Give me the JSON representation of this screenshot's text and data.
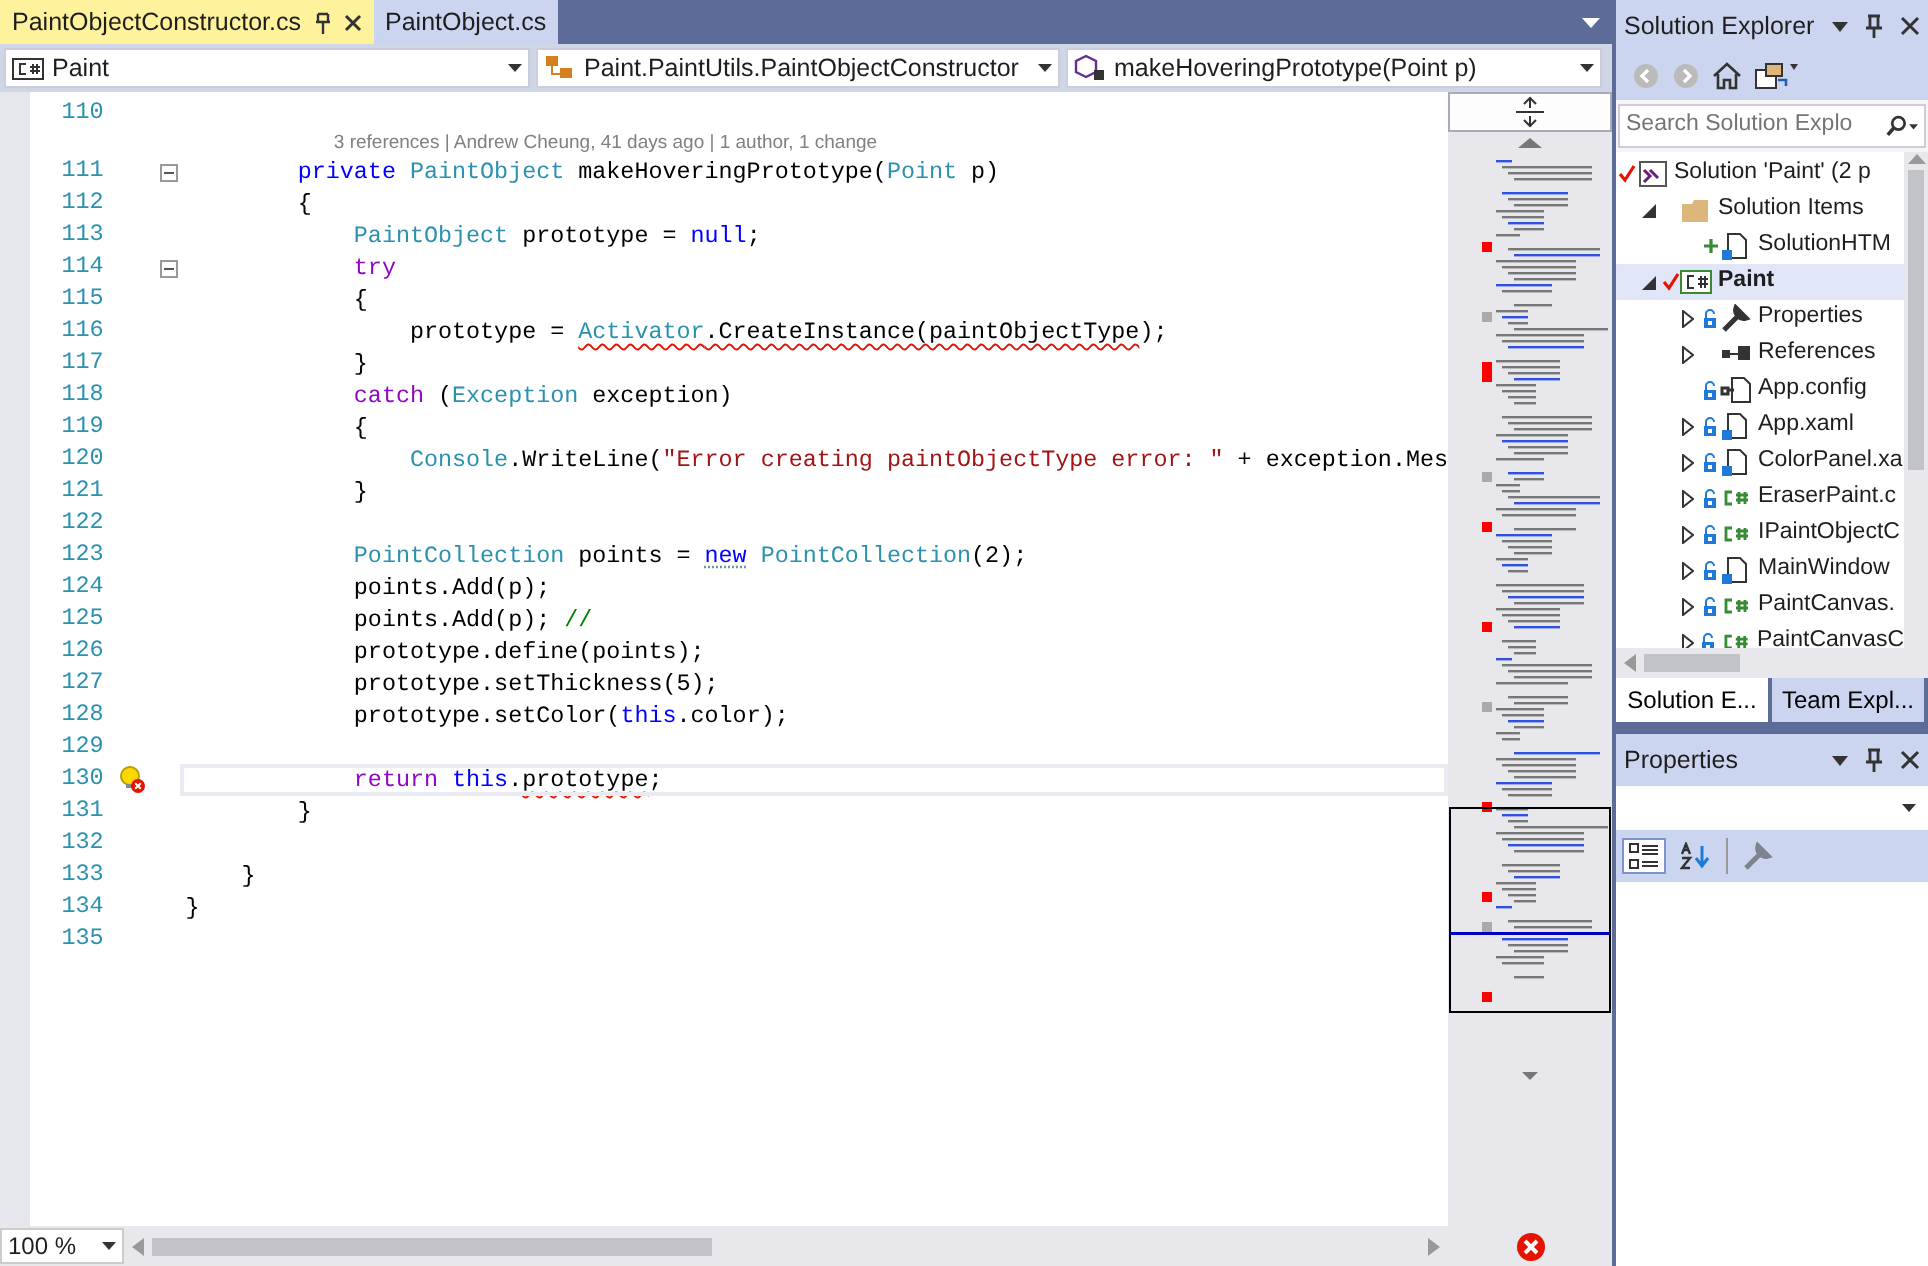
{
  "editor_tabs": [
    {
      "label": "PaintObjectConstructor.cs",
      "selected": true
    },
    {
      "label": "PaintObject.cs",
      "selected": false
    }
  ],
  "nav_bar": [
    {
      "kind": "project",
      "label": "Paint"
    },
    {
      "kind": "class",
      "label": "Paint.PaintUtils.PaintObjectConstructor"
    },
    {
      "kind": "member",
      "label": "makeHoveringPrototype(Point p)"
    }
  ],
  "code_lines": [
    {
      "number": "110",
      "fold": false,
      "current": false,
      "lightbulb": false
    },
    {
      "number": "111",
      "fold": true,
      "current": false,
      "lightbulb": false,
      "code_lens": "3 references | Andrew Cheung, 41 days ago | 1 author, 1 change",
      "tokens": [
        {
          "t": "        private ",
          "kind": "keyword"
        },
        {
          "t": "PaintObject",
          "kind": "type"
        },
        {
          "t": " makeHoveringPrototype(",
          "kind": "plain"
        },
        {
          "t": "Point",
          "kind": "type"
        },
        {
          "t": " p)",
          "kind": "plain"
        }
      ]
    },
    {
      "number": "112",
      "fold": false,
      "current": false,
      "lightbulb": false,
      "tokens": [
        {
          "t": "        {",
          "kind": "plain"
        }
      ]
    },
    {
      "number": "113",
      "fold": false,
      "current": false,
      "lightbulb": false,
      "tokens": [
        {
          "t": "            PaintObject",
          "kind": "type"
        },
        {
          "t": " prototype = ",
          "kind": "plain"
        },
        {
          "t": "null",
          "kind": "keyword"
        },
        {
          "t": ";",
          "kind": "plain"
        }
      ]
    },
    {
      "number": "114",
      "fold": true,
      "current": false,
      "lightbulb": false,
      "tokens": [
        {
          "t": "            try",
          "kind": "control"
        }
      ]
    },
    {
      "number": "115",
      "fold": false,
      "current": false,
      "lightbulb": false,
      "tokens": [
        {
          "t": "            {",
          "kind": "plain"
        }
      ]
    },
    {
      "number": "116",
      "fold": false,
      "current": false,
      "lightbulb": false,
      "tokens": [
        {
          "t": "                prototype = ",
          "kind": "plain"
        },
        {
          "t": "Activator",
          "kind": "type",
          "error_underline": true
        },
        {
          "t": ".CreateInstance(paintObjectType",
          "kind": "plain",
          "error_underline": true
        },
        {
          "t": ");",
          "kind": "plain"
        }
      ]
    },
    {
      "number": "117",
      "fold": false,
      "current": false,
      "lightbulb": false,
      "tokens": [
        {
          "t": "            }",
          "kind": "plain"
        }
      ]
    },
    {
      "number": "118",
      "fold": false,
      "current": false,
      "lightbulb": false,
      "tokens": [
        {
          "t": "            catch",
          "kind": "control"
        },
        {
          "t": " (",
          "kind": "plain"
        },
        {
          "t": "Exception",
          "kind": "type"
        },
        {
          "t": " exception)",
          "kind": "plain"
        }
      ]
    },
    {
      "number": "119",
      "fold": false,
      "current": false,
      "lightbulb": false,
      "tokens": [
        {
          "t": "            {",
          "kind": "plain"
        }
      ]
    },
    {
      "number": "120",
      "fold": false,
      "current": false,
      "lightbulb": false,
      "tokens": [
        {
          "t": "                Console",
          "kind": "type"
        },
        {
          "t": ".WriteLine(",
          "kind": "plain"
        },
        {
          "t": "\"Error creating paintObjectType error: \"",
          "kind": "string"
        },
        {
          "t": " + exception.Mes",
          "kind": "plain"
        }
      ]
    },
    {
      "number": "121",
      "fold": false,
      "current": false,
      "lightbulb": false,
      "tokens": [
        {
          "t": "            }",
          "kind": "plain"
        }
      ]
    },
    {
      "number": "122",
      "fold": false,
      "current": false,
      "lightbulb": false
    },
    {
      "number": "123",
      "fold": false,
      "current": false,
      "lightbulb": false,
      "tokens": [
        {
          "t": "            PointCollection",
          "kind": "type"
        },
        {
          "t": " points = ",
          "kind": "plain"
        },
        {
          "t": "new",
          "kind": "keyword",
          "hint_underline": true
        },
        {
          "t": " PointCollection",
          "kind": "type"
        },
        {
          "t": "(2);",
          "kind": "plain"
        }
      ]
    },
    {
      "number": "124",
      "fold": false,
      "current": false,
      "lightbulb": false,
      "tokens": [
        {
          "t": "            points.Add(p);",
          "kind": "plain"
        }
      ]
    },
    {
      "number": "125",
      "fold": false,
      "current": false,
      "lightbulb": false,
      "tokens": [
        {
          "t": "            points.Add(p); ",
          "kind": "plain"
        },
        {
          "t": "//",
          "kind": "comment"
        }
      ]
    },
    {
      "number": "126",
      "fold": false,
      "current": false,
      "lightbulb": false,
      "tokens": [
        {
          "t": "            prototype.define(points);",
          "kind": "plain"
        }
      ]
    },
    {
      "number": "127",
      "fold": false,
      "current": false,
      "lightbulb": false,
      "tokens": [
        {
          "t": "            prototype.setThickness(5);",
          "kind": "plain"
        }
      ]
    },
    {
      "number": "128",
      "fold": false,
      "current": false,
      "lightbulb": false,
      "tokens": [
        {
          "t": "            prototype.setColor(",
          "kind": "plain"
        },
        {
          "t": "this",
          "kind": "keyword"
        },
        {
          "t": ".color);",
          "kind": "plain"
        }
      ]
    },
    {
      "number": "129",
      "fold": false,
      "current": false,
      "lightbulb": false
    },
    {
      "number": "130",
      "fold": false,
      "current": true,
      "lightbulb": true,
      "tokens": [
        {
          "t": "            return ",
          "kind": "control"
        },
        {
          "t": "this",
          "kind": "keyword"
        },
        {
          "t": ".",
          "kind": "plain"
        },
        {
          "t": "prototype",
          "kind": "plain",
          "error_underline": true
        },
        {
          "t": ";",
          "kind": "plain"
        }
      ]
    },
    {
      "number": "131",
      "fold": false,
      "current": false,
      "lightbulb": false,
      "tokens": [
        {
          "t": "        }",
          "kind": "plain"
        }
      ]
    },
    {
      "number": "132",
      "fold": false,
      "current": false,
      "lightbulb": false
    },
    {
      "number": "133",
      "fold": false,
      "current": false,
      "lightbulb": false,
      "tokens": [
        {
          "t": "    }",
          "kind": "plain"
        }
      ]
    },
    {
      "number": "134",
      "fold": false,
      "current": false,
      "lightbulb": false,
      "tokens": [
        {
          "t": "}",
          "kind": "plain"
        }
      ]
    },
    {
      "number": "135",
      "fold": false,
      "current": false,
      "lightbulb": false
    }
  ],
  "zoom": "100 %",
  "solution_explorer": {
    "title": "Solution Explorer",
    "search": {
      "placeholder": "Search Solution Explo"
    },
    "tree": [
      {
        "label": "Solution 'Paint' (2 p",
        "kind": "solution",
        "edited": true,
        "added": false,
        "locked": false,
        "selected": false,
        "children": [
          {
            "label": "Solution Items",
            "kind": "folder",
            "expanded": true,
            "edited": false,
            "added": false,
            "locked": false,
            "selected": false,
            "children": [
              {
                "label": "SolutionHTM",
                "kind": "page",
                "edited": false,
                "added": true,
                "locked": false,
                "selected": false
              }
            ]
          },
          {
            "label": "Paint",
            "kind": "project",
            "expanded": true,
            "edited": true,
            "added": false,
            "locked": false,
            "selected": true,
            "children": [
              {
                "label": "Properties",
                "kind": "wrench",
                "expanded": false,
                "edited": false,
                "added": false,
                "locked": true,
                "selected": false
              },
              {
                "label": "References",
                "kind": "references",
                "expanded": false,
                "edited": false,
                "added": false,
                "locked": false,
                "selected": false
              },
              {
                "label": "App.config",
                "kind": "config",
                "edited": false,
                "added": false,
                "locked": true,
                "selected": false
              },
              {
                "label": "App.xaml",
                "kind": "page",
                "expanded": false,
                "edited": false,
                "added": false,
                "locked": true,
                "selected": false
              },
              {
                "label": "ColorPanel.xa",
                "kind": "page",
                "expanded": false,
                "edited": false,
                "added": false,
                "locked": true,
                "selected": false
              },
              {
                "label": "EraserPaint.c",
                "kind": "cs",
                "expanded": false,
                "edited": false,
                "added": false,
                "locked": true,
                "selected": false
              },
              {
                "label": "IPaintObjectC",
                "kind": "cs",
                "expanded": false,
                "edited": false,
                "added": false,
                "locked": true,
                "selected": false
              },
              {
                "label": "MainWindow",
                "kind": "page",
                "expanded": false,
                "edited": false,
                "added": false,
                "locked": true,
                "selected": false
              },
              {
                "label": "PaintCanvas.",
                "kind": "cs",
                "expanded": false,
                "edited": false,
                "added": false,
                "locked": true,
                "selected": false
              },
              {
                "label": "PaintCanvasC",
                "kind": "cs",
                "expanded": false,
                "edited": false,
                "added": false,
                "locked": true,
                "selected": false
              }
            ]
          }
        ]
      }
    ]
  },
  "panel_tabs": [
    {
      "label": "Solution E...",
      "selected": true
    },
    {
      "label": "Team Expl...",
      "selected": false
    }
  ],
  "properties": {
    "title": "Properties",
    "tools": [
      {
        "kind": "categorized",
        "selected": true,
        "disabled": false
      },
      {
        "kind": "alphabetical",
        "selected": false,
        "disabled": false
      },
      {
        "kind": "pages",
        "selected": false,
        "disabled": true
      }
    ]
  }
}
